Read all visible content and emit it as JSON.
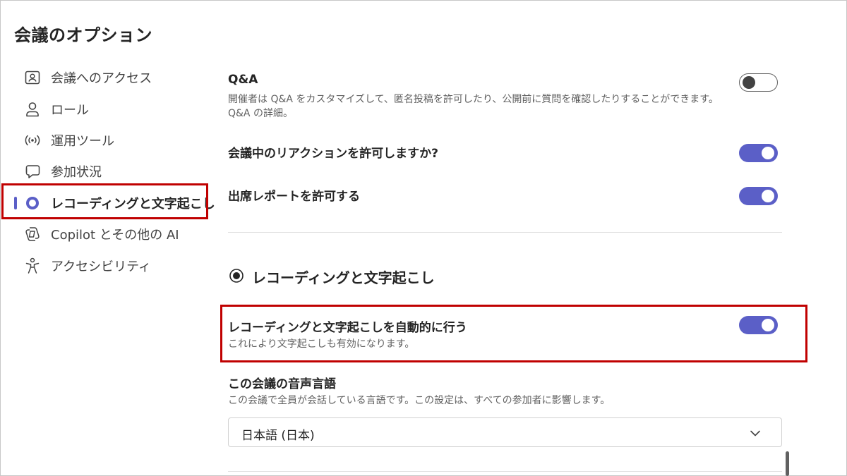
{
  "page": {
    "title": "会議のオプション"
  },
  "sidebar": {
    "items": [
      {
        "label": "会議へのアクセス",
        "icon": "person-card-icon"
      },
      {
        "label": "ロール",
        "icon": "person-icon"
      },
      {
        "label": "運用ツール",
        "icon": "broadcast-icon"
      },
      {
        "label": "参加状況",
        "icon": "chat-bubble-icon"
      },
      {
        "label": "レコーディングと文字起こし",
        "icon": "record-icon",
        "active": true
      },
      {
        "label": "Copilot とその他の AI",
        "icon": "copilot-icon"
      },
      {
        "label": "アクセシビリティ",
        "icon": "accessibility-icon"
      }
    ]
  },
  "settings": {
    "qa": {
      "title": "Q&A",
      "desc_line1": "開催者は Q&A をカスタマイズして、匿名投稿を許可したり、公開前に質問を確認したりすることができます。",
      "desc_line2": "Q&A の詳細。",
      "enabled": false
    },
    "reactions": {
      "title": "会議中のリアクションを許可しますか?",
      "enabled": true
    },
    "attendance": {
      "title": "出席レポートを許可する",
      "enabled": true
    }
  },
  "recording_section": {
    "title": "レコーディングと文字起こし",
    "auto_record": {
      "title": "レコーディングと文字起こしを自動的に行う",
      "desc": "これにより文字起こしも有効になります。",
      "enabled": true
    },
    "language": {
      "title": "この会議の音声言語",
      "desc": "この会議で全員が会話している言語です。この設定は、すべての参加者に影響します。",
      "selected": "日本語 (日本)"
    }
  },
  "colors": {
    "accent": "#5b5fc7",
    "highlight": "#c00000"
  }
}
